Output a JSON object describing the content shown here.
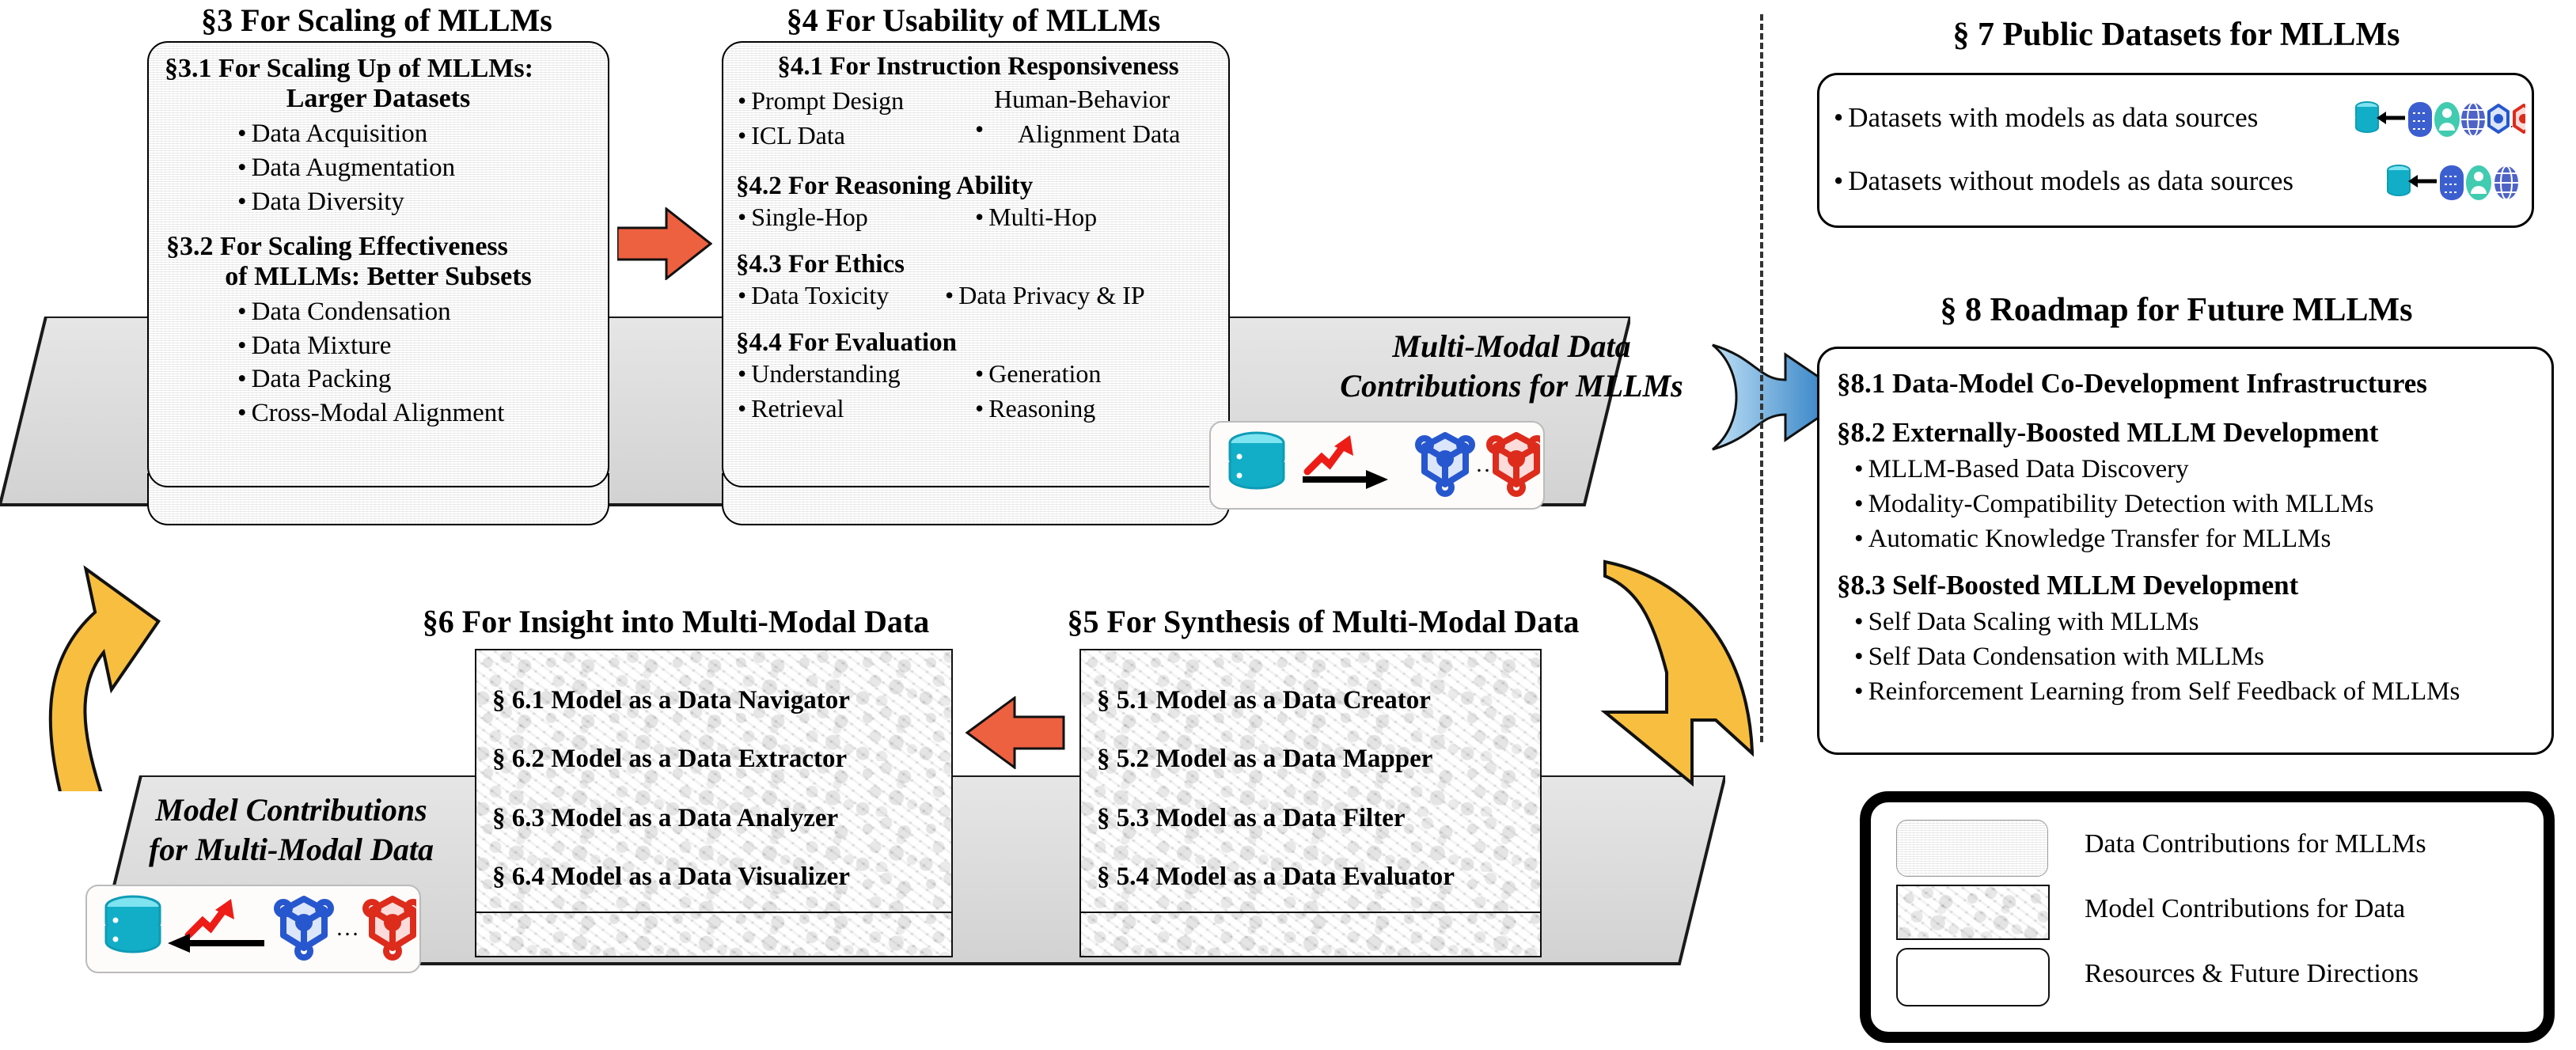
{
  "sections": {
    "s3": {
      "title": "§3  For Scaling of MLLMs",
      "sub1_line1": "§3.1  For Scaling Up of MLLMs:",
      "sub1_line2": "Larger Datasets",
      "sub1_items": [
        "Data Acquisition",
        "Data Augmentation",
        "Data Diversity"
      ],
      "sub2_line1": "§3.2  For Scaling Effectiveness",
      "sub2_line2": "of MLLMs: Better Subsets",
      "sub2_items": [
        "Data Condensation",
        "Data Mixture",
        "Data Packing",
        "Cross-Modal Alignment"
      ]
    },
    "s4": {
      "title": "§4  For Usability of MLLMs",
      "sub1": "§4.1  For Instruction Responsiveness",
      "sub1_left": [
        "Prompt Design",
        "ICL Data"
      ],
      "sub1_right_line1": "Human-Behavior",
      "sub1_right_line2": "Alignment Data",
      "sub2": "§4.2  For Reasoning Ability",
      "sub2_items": [
        "Single-Hop",
        "Multi-Hop"
      ],
      "sub3": "§4.3  For Ethics",
      "sub3_items": [
        "Data Toxicity",
        "Data Privacy & IP"
      ],
      "sub4": "§4.4  For Evaluation",
      "sub4_items": [
        "Understanding",
        "Generation",
        "Retrieval",
        "Reasoning"
      ]
    },
    "s5": {
      "title": "§5  For Synthesis of Multi-Modal Data",
      "items": [
        "§ 5.1  Model as a Data Creator",
        "§ 5.2  Model as a Data Mapper",
        "§ 5.3  Model as a Data Filter",
        "§ 5.4  Model as a Data Evaluator"
      ]
    },
    "s6": {
      "title": "§6  For Insight into Multi-Modal Data",
      "items": [
        "§ 6.1  Model as a Data Navigator",
        "§ 6.2  Model as a Data Extractor",
        "§ 6.3  Model as a Data Analyzer",
        "§ 6.4  Model as a Data Visualizer"
      ]
    },
    "s7": {
      "title": "§ 7  Public Datasets for MLLMs",
      "items": [
        "Datasets with models as data sources",
        "Datasets without models as data sources"
      ]
    },
    "s8": {
      "title": "§ 8  Roadmap for Future MLLMs",
      "sub1": "§8.1  Data-Model Co-Development Infrastructures",
      "sub2": "§8.2  Externally-Boosted MLLM Development",
      "sub2_items": [
        "MLLM-Based Data Discovery",
        "Modality-Compatibility Detection with MLLMs",
        "Automatic Knowledge Transfer for MLLMs"
      ],
      "sub3": "§8.3  Self-Boosted MLLM Development",
      "sub3_items": [
        "Self Data Scaling with MLLMs",
        "Self Data Condensation with MLLMs",
        "Reinforcement Learning from Self Feedback of MLLMs"
      ]
    }
  },
  "bands": {
    "top_label_line1": "Multi-Modal Data",
    "top_label_line2": "Contributions for MLLMs",
    "bottom_label_line1": "Model Contributions",
    "bottom_label_line2": "for Multi-Modal Data"
  },
  "legend": {
    "items": [
      "Data Contributions for MLLMs",
      "Model Contributions for Data",
      "Resources & Future Directions"
    ]
  },
  "icons": {
    "database": "database-icon",
    "trend_arrow": "red-trend-arrow-icon",
    "arrow_right": "black-right-arrow-icon",
    "arrow_left": "black-left-arrow-icon",
    "model_blue": "blue-model-node-icon",
    "model_red": "red-model-node-icon",
    "ellipsis": "…",
    "person": "person-icon",
    "globe": "globe-icon",
    "db_blue": "blue-database-icon"
  },
  "colors": {
    "red_arrow": "#ED6040",
    "yellow_arrow": "#F7BE3F",
    "blue_arrow": "#2079C4",
    "model_blue": "#2757CE",
    "model_red": "#DD2B1C",
    "db_cyan": "#1AAFC8",
    "db_blue": "#3C5FD0",
    "person_teal": "#41CBB0",
    "globe_blue": "#4F63C6"
  }
}
